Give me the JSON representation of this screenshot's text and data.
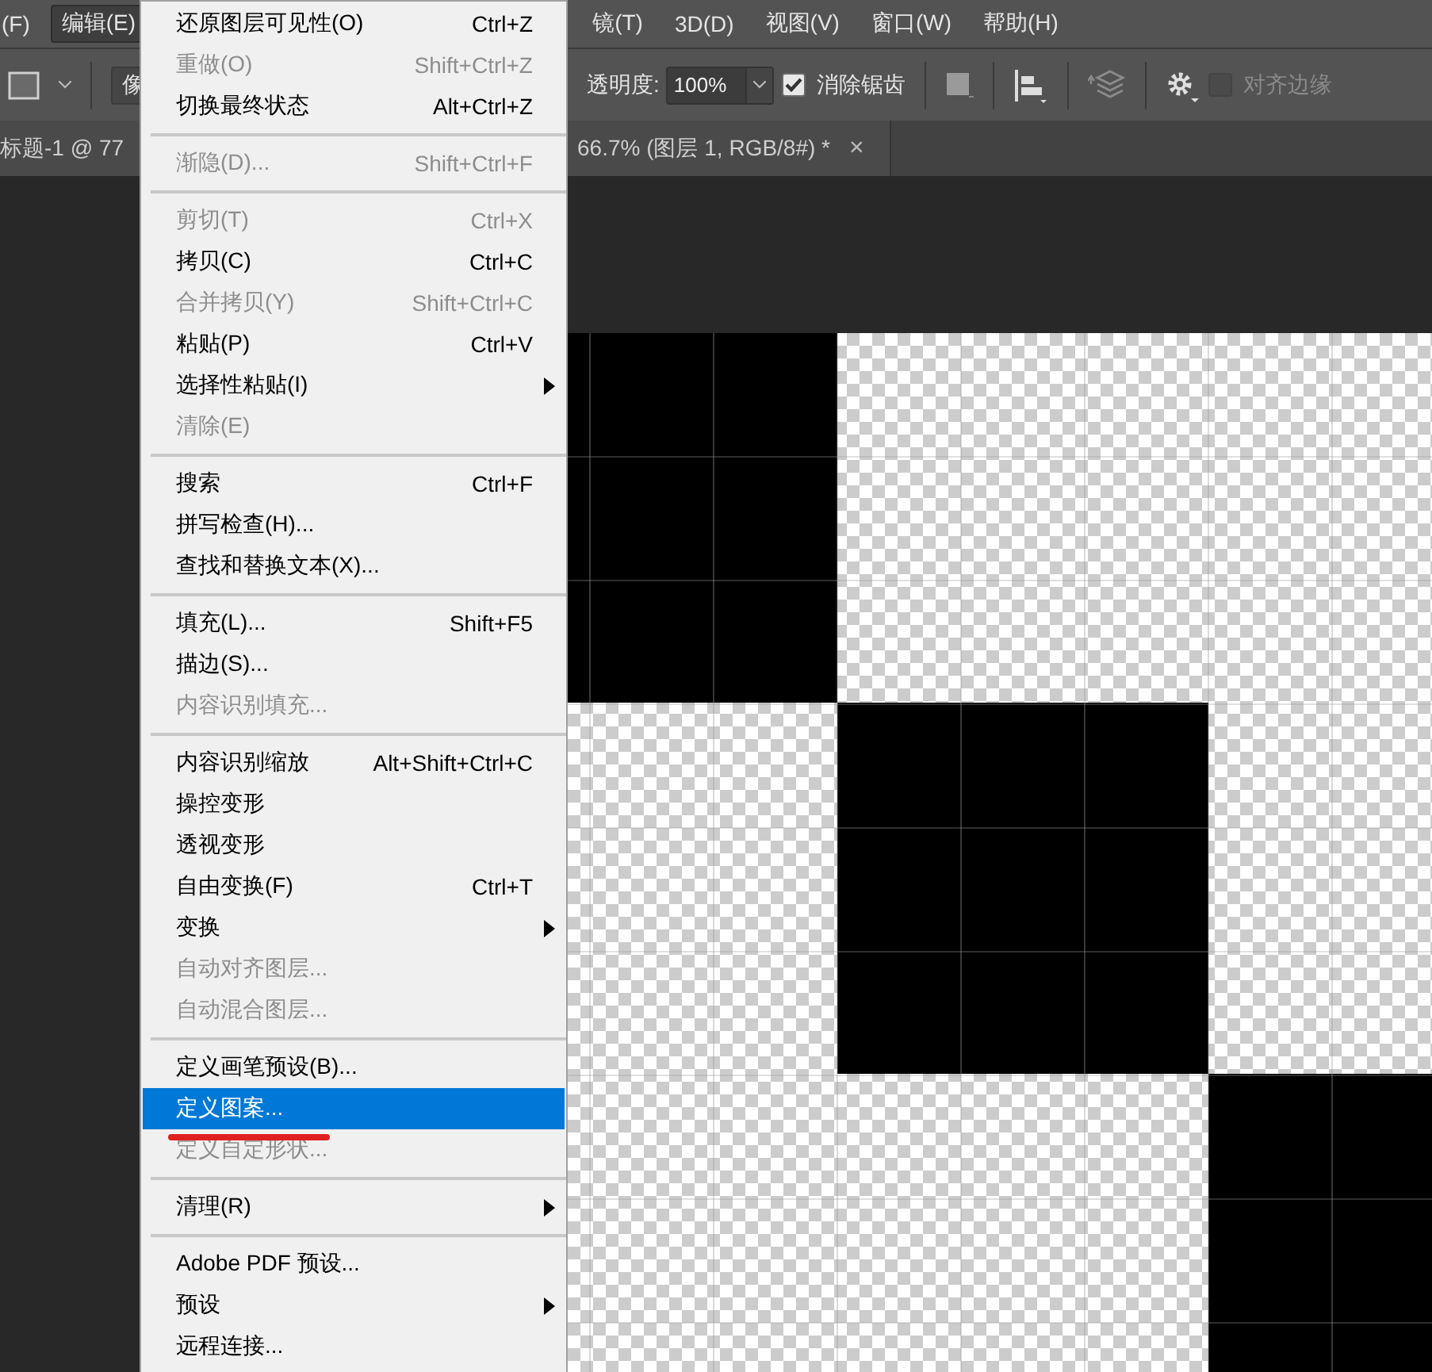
{
  "menubar": {
    "left": [
      {
        "label": "(F)",
        "selected": false
      },
      {
        "label": "编辑(E)",
        "selected": true
      }
    ],
    "right": [
      {
        "label": "镜(T)",
        "selected": false
      },
      {
        "label": "3D(D)",
        "selected": false
      },
      {
        "label": "视图(V)",
        "selected": false
      },
      {
        "label": "窗口(W)",
        "selected": false
      },
      {
        "label": "帮助(H)",
        "selected": false
      }
    ]
  },
  "options": {
    "tool_field": "像",
    "opacity_label": "透明度:",
    "opacity_value": "100%",
    "anti_alias": {
      "label": "消除锯齿",
      "checked": true,
      "disabled": false
    },
    "align_edges": {
      "label": "对齐边缘",
      "checked": false,
      "disabled": true
    }
  },
  "tabs": [
    {
      "title": "标题-1 @ 77"
    },
    {
      "title": "66.7% (图层 1, RGB/8#) *",
      "close": "×"
    }
  ],
  "menu": {
    "items": [
      {
        "kind": "item",
        "label": "还原图层可见性(O)",
        "shortcut": "Ctrl+Z",
        "disabled": false,
        "submenu": false,
        "selected": false
      },
      {
        "kind": "item",
        "label": "重做(O)",
        "shortcut": "Shift+Ctrl+Z",
        "disabled": true,
        "submenu": false,
        "selected": false
      },
      {
        "kind": "item",
        "label": "切换最终状态",
        "shortcut": "Alt+Ctrl+Z",
        "disabled": false,
        "submenu": false,
        "selected": false
      },
      {
        "kind": "separator"
      },
      {
        "kind": "item",
        "label": "渐隐(D)...",
        "shortcut": "Shift+Ctrl+F",
        "disabled": true,
        "submenu": false,
        "selected": false
      },
      {
        "kind": "separator"
      },
      {
        "kind": "item",
        "label": "剪切(T)",
        "shortcut": "Ctrl+X",
        "disabled": true,
        "submenu": false,
        "selected": false
      },
      {
        "kind": "item",
        "label": "拷贝(C)",
        "shortcut": "Ctrl+C",
        "disabled": false,
        "submenu": false,
        "selected": false
      },
      {
        "kind": "item",
        "label": "合并拷贝(Y)",
        "shortcut": "Shift+Ctrl+C",
        "disabled": true,
        "submenu": false,
        "selected": false
      },
      {
        "kind": "item",
        "label": "粘贴(P)",
        "shortcut": "Ctrl+V",
        "disabled": false,
        "submenu": false,
        "selected": false
      },
      {
        "kind": "item",
        "label": "选择性粘贴(I)",
        "disabled": false,
        "submenu": true,
        "selected": false
      },
      {
        "kind": "item",
        "label": "清除(E)",
        "disabled": true,
        "submenu": false,
        "selected": false
      },
      {
        "kind": "separator"
      },
      {
        "kind": "item",
        "label": "搜索",
        "shortcut": "Ctrl+F",
        "disabled": false,
        "submenu": false,
        "selected": false
      },
      {
        "kind": "item",
        "label": "拼写检查(H)...",
        "disabled": false,
        "submenu": false,
        "selected": false
      },
      {
        "kind": "item",
        "label": "查找和替换文本(X)...",
        "disabled": false,
        "submenu": false,
        "selected": false
      },
      {
        "kind": "separator"
      },
      {
        "kind": "item",
        "label": "填充(L)...",
        "shortcut": "Shift+F5",
        "disabled": false,
        "submenu": false,
        "selected": false
      },
      {
        "kind": "item",
        "label": "描边(S)...",
        "disabled": false,
        "submenu": false,
        "selected": false
      },
      {
        "kind": "item",
        "label": "内容识别填充...",
        "disabled": true,
        "submenu": false,
        "selected": false
      },
      {
        "kind": "separator"
      },
      {
        "kind": "item",
        "label": "内容识别缩放",
        "shortcut": "Alt+Shift+Ctrl+C",
        "disabled": false,
        "submenu": false,
        "selected": false
      },
      {
        "kind": "item",
        "label": "操控变形",
        "disabled": false,
        "submenu": false,
        "selected": false
      },
      {
        "kind": "item",
        "label": "透视变形",
        "disabled": false,
        "submenu": false,
        "selected": false
      },
      {
        "kind": "item",
        "label": "自由变换(F)",
        "shortcut": "Ctrl+T",
        "disabled": false,
        "submenu": false,
        "selected": false
      },
      {
        "kind": "item",
        "label": "变换",
        "disabled": false,
        "submenu": true,
        "selected": false
      },
      {
        "kind": "item",
        "label": "自动对齐图层...",
        "disabled": true,
        "submenu": false,
        "selected": false
      },
      {
        "kind": "item",
        "label": "自动混合图层...",
        "disabled": true,
        "submenu": false,
        "selected": false
      },
      {
        "kind": "separator"
      },
      {
        "kind": "item",
        "label": "定义画笔预设(B)...",
        "disabled": false,
        "submenu": false,
        "selected": false
      },
      {
        "kind": "item",
        "label": "定义图案...",
        "disabled": false,
        "submenu": false,
        "selected": true
      },
      {
        "kind": "item",
        "label": "定义自定形状...",
        "disabled": true,
        "submenu": false,
        "selected": false
      },
      {
        "kind": "separator"
      },
      {
        "kind": "item",
        "label": "清理(R)",
        "disabled": false,
        "submenu": true,
        "selected": false
      },
      {
        "kind": "separator"
      },
      {
        "kind": "item",
        "label": "Adobe PDF 预设...",
        "disabled": false,
        "submenu": false,
        "selected": false
      },
      {
        "kind": "item",
        "label": "预设",
        "disabled": false,
        "submenu": true,
        "selected": false
      },
      {
        "kind": "item",
        "label": "远程连接...",
        "disabled": false,
        "submenu": false,
        "selected": false
      }
    ]
  }
}
